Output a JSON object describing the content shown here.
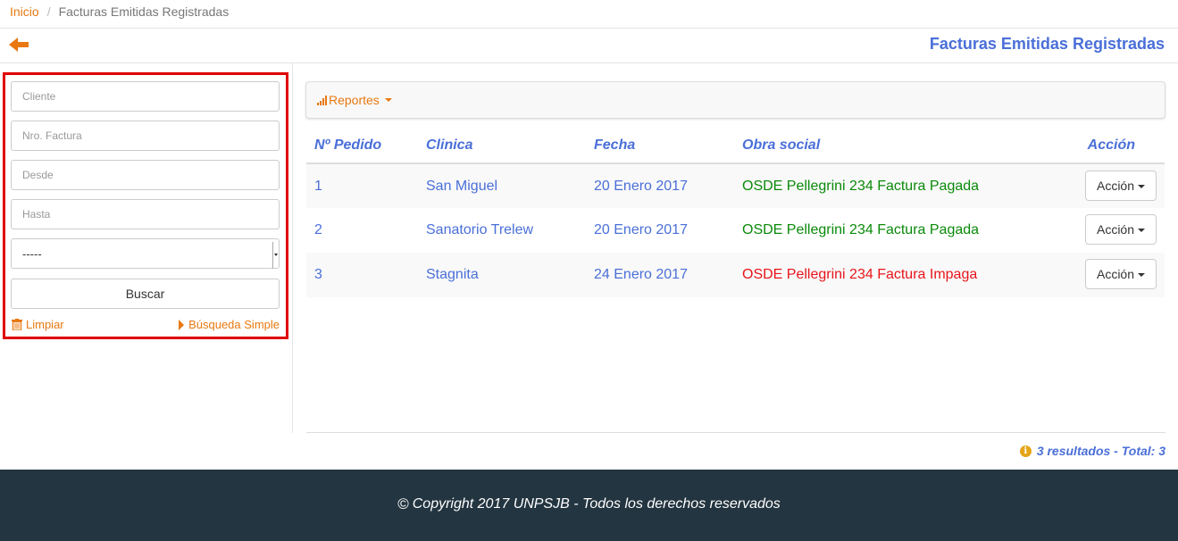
{
  "breadcrumb": {
    "home": "Inicio",
    "separator": "/",
    "current": "Facturas Emitidas Registradas"
  },
  "header": {
    "title": "Facturas Emitidas Registradas",
    "back_icon": "arrow-left-icon"
  },
  "filters": {
    "cliente_placeholder": "Cliente",
    "factura_placeholder": "Nro. Factura",
    "desde_placeholder": "Desde",
    "hasta_placeholder": "Hasta",
    "select_value": "-----",
    "buscar_label": "Buscar",
    "limpiar_label": "Limpiar",
    "busqueda_label": "Búsqueda Simple"
  },
  "toolbar": {
    "reportes_label": "Reportes"
  },
  "table": {
    "headers": {
      "pedido": "Nº Pedido",
      "clinica": "Clinica",
      "fecha": "Fecha",
      "obra": "Obra social",
      "accion": "Acción"
    },
    "rows": [
      {
        "pedido": "1",
        "clinica": "San Miguel",
        "fecha": "20 Enero 2017",
        "obra": "OSDE Pellegrini 234 Factura Pagada",
        "accion": "Acción"
      },
      {
        "pedido": "2",
        "clinica": "Sanatorio Trelew",
        "fecha": "20 Enero 2017",
        "obra": "OSDE Pellegrini 234 Factura Pagada",
        "accion": "Acción"
      },
      {
        "pedido": "3",
        "clinica": "Stagnita",
        "fecha": "24 Enero 2017",
        "obra": "OSDE Pellegrini 234 Factura Impaga",
        "accion": "Acción"
      }
    ]
  },
  "summary": {
    "results_text": "3 resultados - Total: 3"
  },
  "footer": {
    "copyright": "Copyright 2017 UNPSJB - Todos los derechos reservados"
  },
  "colors": {
    "accent": "#e8780f",
    "primary": "#4a6fd8",
    "paid": "#0a8a0a",
    "unpaid": "#e8141a",
    "footer_bg": "#233540",
    "highlight_border": "#e00000"
  }
}
